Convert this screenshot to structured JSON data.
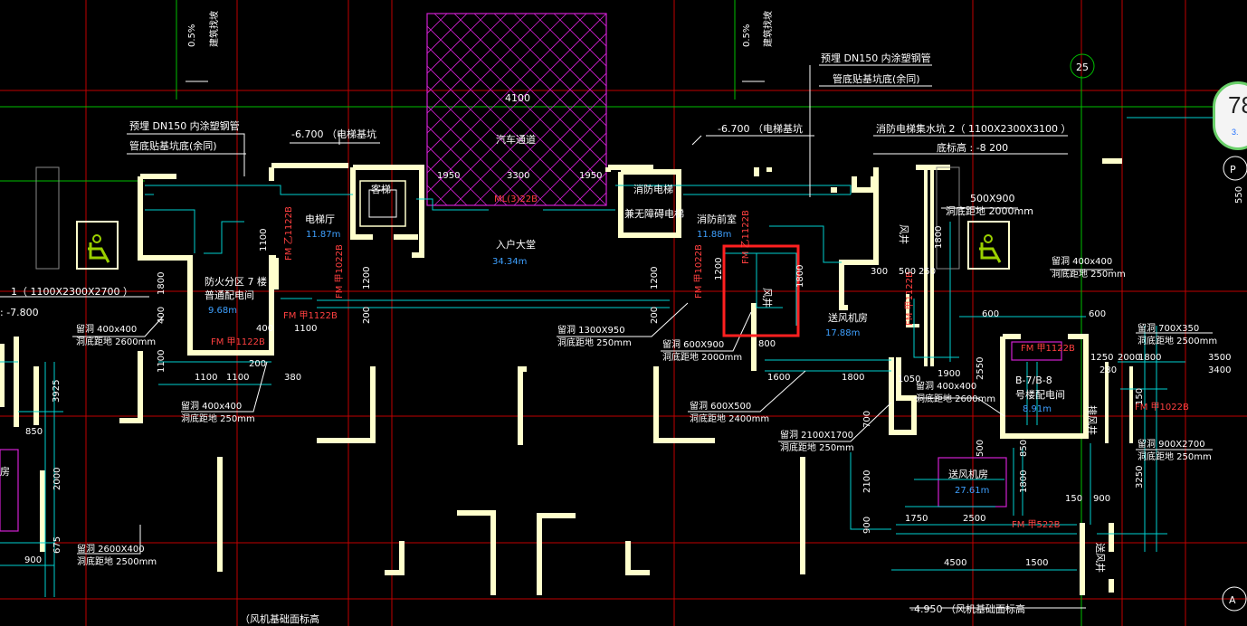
{
  "drawing": {
    "axes": {
      "a25": "25",
      "aP": "P",
      "aA": "A"
    },
    "edge_labels": {
      "top_slope_left": "0.5%",
      "top_slope_left_b": "建筑找坡",
      "top_slope_right": "0.5%",
      "top_slope_right_b": "建筑找坡",
      "right_550": "550",
      "right_3400": "3400",
      "right_3500": "3500"
    },
    "notes": {
      "pipe_left_1": "预埋 DN150  内涂塑钢管",
      "pipe_left_2": "管底贴基坑底(余同)",
      "pipe_right_1": "预埋 DN150  内涂塑钢管",
      "pipe_right_2": "管底贴基坑底(余同)",
      "pit_left": "-6.700  （电梯基坑",
      "pit_right": "-6.700  （电梯基坑",
      "sump_1": "消防电梯集水坑   2（ 1100X2300X3100    ）",
      "sump_2": "底标高 : -8 200",
      "sump_left": "1（ 1100X2300X2700  ）",
      "sump_left_b": ": -7.800",
      "shaft_top": "500X900",
      "shaft_top_b": "洞底距地 2000mm",
      "bottom_1": "-4.950   （风机基础面标高",
      "bottom_2": "（风机基础面标高"
    },
    "rooms": {
      "passage_w": "4100",
      "passage": "汽车通道",
      "guest_lift": "客梯",
      "lift_hall": "电梯厅",
      "lift_hall_area": "11.87m",
      "lobby": "入户大堂",
      "lobby_area": "34.34m",
      "fire_lift": "消防电梯",
      "fire_lift_b": "兼无障碍电梯",
      "fire_front": "消防前室",
      "fire_front_area": "11.88m",
      "wind_well": "风井",
      "wind_well_r": "风井",
      "supply_fan": "送风机房",
      "supply_fan_area": "17.88m",
      "zone": "防火分区 7 楼",
      "zone_b": "普通配电间",
      "zone_area": "9.68m",
      "bay": "B-7/B-8",
      "bay_b": "号楼配电间",
      "bay_area": "8.91m",
      "supply_fan2": "送风机房",
      "supply_fan2_area": "27.61m",
      "exhaust": "排风井",
      "supply_well": "送风井",
      "left_room": "房"
    },
    "doors": {
      "ml": "ML(3)22B",
      "fm_lift": "FM 乙1122B",
      "fm_front": "FM 乙1122B",
      "fm_zone": "FM 甲1122B",
      "fm_zone2": "FM 甲1122B",
      "fm_1022": "FM 甲1022B",
      "fm_stair": "FM 甲1022B",
      "fm_right": "FM 甲1122B",
      "fm_bay": "FM 甲1122B",
      "fm_fan2": "FM 甲522B",
      "fm_exh": "FM 甲1022B"
    },
    "openings": {
      "o1": "留洞  400x400",
      "o1b": "洞底距地 2600mm",
      "o2": "留洞  1300X950",
      "o2b": "洞底距地 250mm",
      "o3": "留洞  600X900",
      "o3b": "洞底距地 2000mm",
      "o4": "留洞  400x400",
      "o4b": "洞底距地  250mm",
      "o5": "留洞  600X500",
      "o5b": "洞底距地 2400mm",
      "o6": "留洞  2100X1700",
      "o6b": "洞底距地 250mm",
      "o7": "留洞  400x400",
      "o7b": "洞底距地 2600mm",
      "o8": "留洞  400x400",
      "o8b": "洞底距地  250mm",
      "o9": "留洞  700X350",
      "o9b": "洞底距地 2500mm",
      "o10": "留洞  900X2700",
      "o10b": "洞底距地 250mm",
      "o11": "留洞  2600X400",
      "o11b": "洞底距地 2500mm"
    },
    "dims": {
      "d1950a": "1950",
      "d3300": "3300",
      "d1950b": "1950",
      "d1800": "1800",
      "d400": "400",
      "d1100v": "1100",
      "d1100a": "1100",
      "d1100b": "1100",
      "d200": "200",
      "d380": "380",
      "d1200a": "1200",
      "d1200b": "1200",
      "d1200c": "1200",
      "d1800b": "1800",
      "d200b": "200",
      "d1100c": "1100",
      "d1600": "1600",
      "d1800c": "1800",
      "d800": "800",
      "d300": "300",
      "d500": "500",
      "d250": "250",
      "d600a": "600",
      "d600b": "600",
      "d1050": "1050",
      "d1900": "1900",
      "d2550": "2550",
      "d1250": "1250",
      "d2000": "2000",
      "d1800d": "1800",
      "d280": "280",
      "d3925": "3925",
      "d850": "850",
      "d2000b": "2000",
      "d675": "675",
      "d900": "900",
      "d700": "700",
      "d2100": "2100",
      "d900b": "900",
      "d1750": "1750",
      "d2500": "2500",
      "d4500": "4500",
      "d1500": "1500",
      "d150": "150",
      "d900c": "900",
      "d3250": "3250",
      "d1800e": "1800",
      "d850b": "850",
      "d500b": "500",
      "d150b": "150",
      "d1800f": "1800"
    }
  },
  "gauge": {
    "value": "78",
    "sub": "3."
  },
  "highlight": {
    "color": "#ff2020"
  }
}
